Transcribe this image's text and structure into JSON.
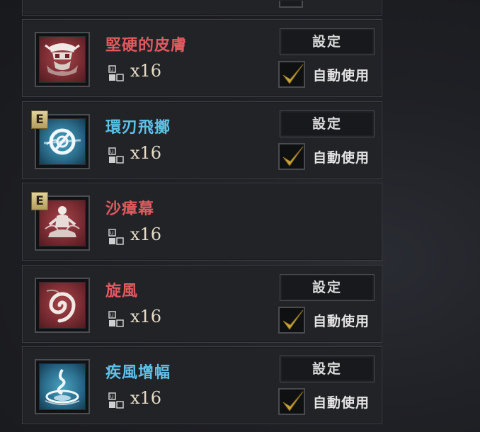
{
  "skills": [
    {
      "name": "堅硬的皮膚",
      "quantity": "x16",
      "name_color": "red",
      "icon": "armored-skull-icon",
      "art_color": "red",
      "badge": null,
      "set_label": "設定",
      "auto_label": "自動使用",
      "auto_checked": true,
      "has_controls": true
    },
    {
      "name": "環刃飛擲",
      "quantity": "x16",
      "name_color": "blue",
      "icon": "spinning-blade-icon",
      "art_color": "blue",
      "badge": "E",
      "set_label": "設定",
      "auto_label": "自動使用",
      "auto_checked": true,
      "has_controls": true
    },
    {
      "name": "沙瘴幕",
      "quantity": "x16",
      "name_color": "red",
      "icon": "meditating-figure-icon",
      "art_color": "red",
      "badge": "E",
      "has_controls": false
    },
    {
      "name": "旋風",
      "quantity": "x16",
      "name_color": "red",
      "icon": "whirlwind-icon",
      "art_color": "red",
      "badge": null,
      "set_label": "設定",
      "auto_label": "自動使用",
      "auto_checked": true,
      "has_controls": true
    },
    {
      "name": "疾風增幅",
      "quantity": "x16",
      "name_color": "blue",
      "icon": "water-vortex-icon",
      "art_color": "blue",
      "badge": null,
      "set_label": "設定",
      "auto_label": "自動使用",
      "auto_checked": true,
      "has_controls": true
    }
  ],
  "colors": {
    "name_red": "#e05a5f",
    "name_blue": "#5fc0e8",
    "check_gold": "#c9a53c",
    "card_bg": "#222327"
  }
}
